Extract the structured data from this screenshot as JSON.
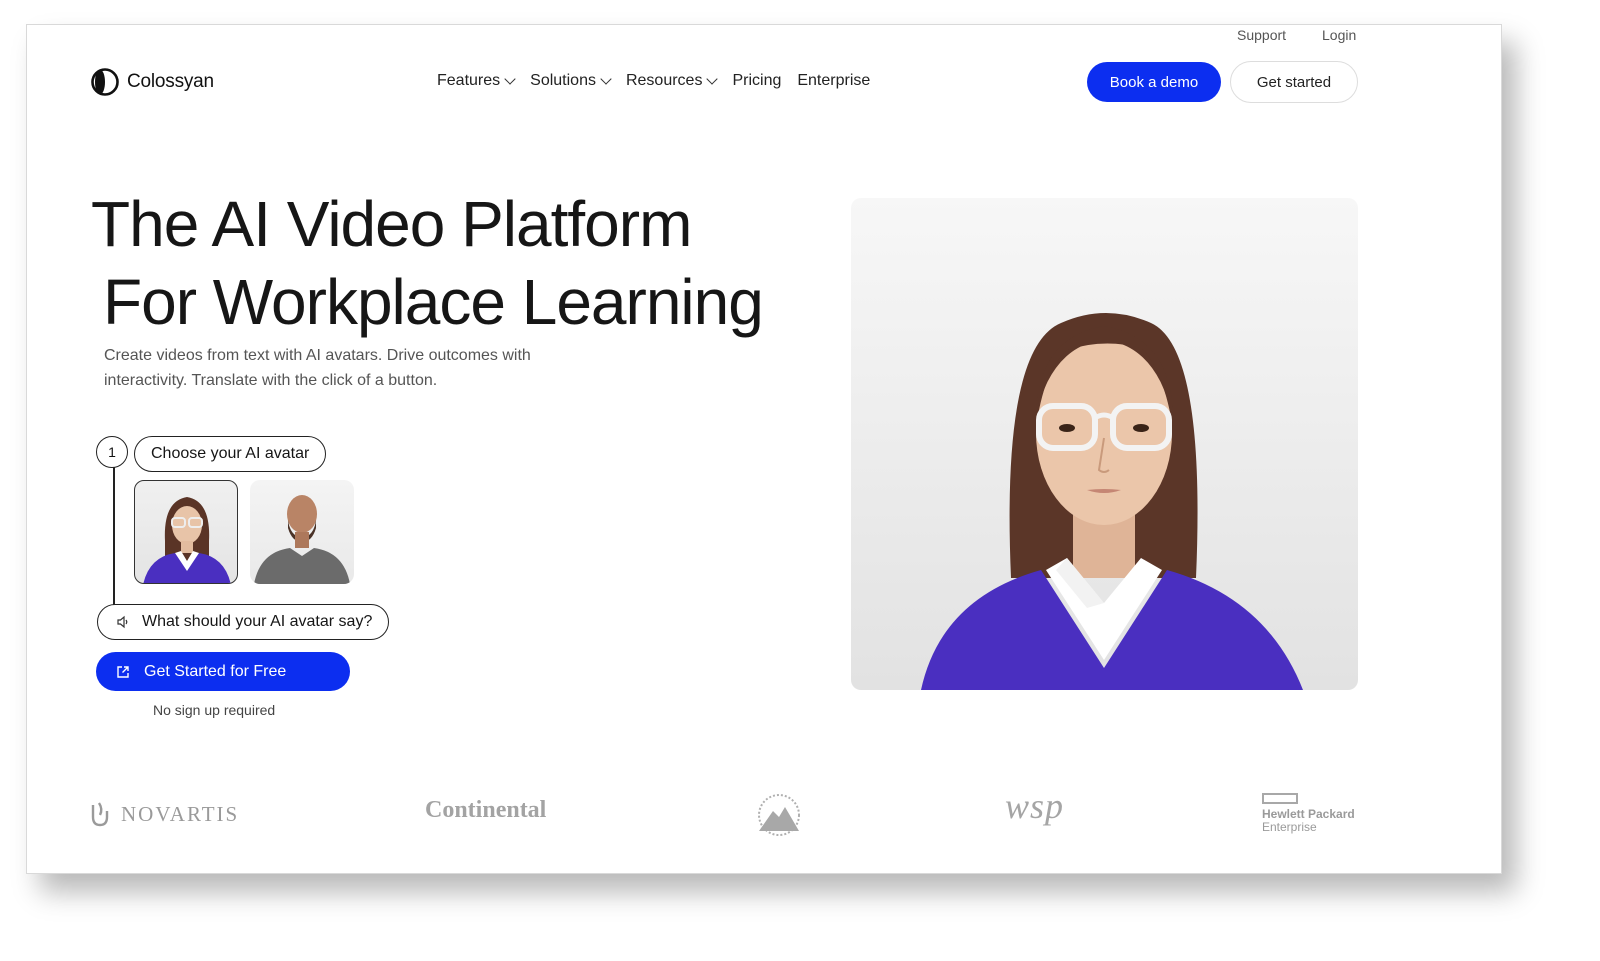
{
  "top_links": {
    "support": "Support",
    "login": "Login"
  },
  "logo": {
    "name": "Colossyan"
  },
  "nav": [
    {
      "label": "Features",
      "has_dropdown": true
    },
    {
      "label": "Solutions",
      "has_dropdown": true
    },
    {
      "label": "Resources",
      "has_dropdown": true
    },
    {
      "label": "Pricing",
      "has_dropdown": false
    },
    {
      "label": "Enterprise",
      "has_dropdown": false
    }
  ],
  "header_buttons": {
    "book_demo": "Book a demo",
    "get_started": "Get started"
  },
  "hero": {
    "title_line1": "The AI Video Platform",
    "title_line2": "For Workplace Learning",
    "subtitle": "Create videos from text with AI avatars. Drive outcomes with interactivity. Translate with the click of a button."
  },
  "steps": {
    "step_number": "1",
    "choose_label": "Choose your AI avatar",
    "say_label": "What should your AI avatar say?",
    "cta_label": "Get Started for Free",
    "note": "No sign up required"
  },
  "client_logos": {
    "novartis": "NOVARTIS",
    "continental": "Continental",
    "wsp": "wsp",
    "hpe_line1": "Hewlett Packard",
    "hpe_line2": "Enterprise"
  },
  "colors": {
    "primary": "#0c2ef0",
    "text": "#161616",
    "muted": "#555555",
    "sweater": "#4a2fc0"
  }
}
